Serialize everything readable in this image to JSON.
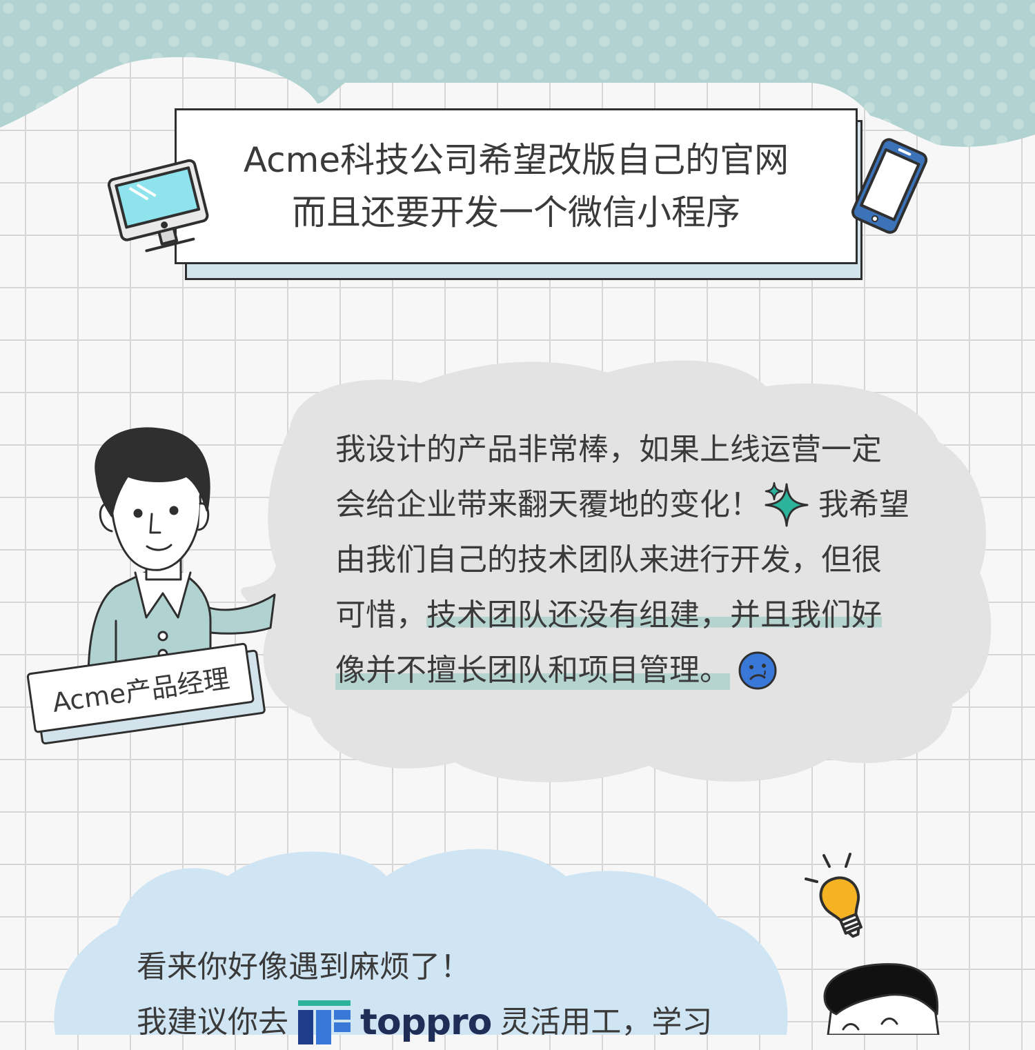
{
  "title": {
    "line1": "Acme科技公司希望改版自己的官网",
    "line2": "而且还要开发一个微信小程序"
  },
  "speech": {
    "row1": "我设计的产品非常棒，如果上线运营一定",
    "row2a": "会给企业带来翻天覆地的变化！",
    "row2b": "我希望",
    "row3": "由我们自己的技术团队来进行开发，但很",
    "row4a": "可惜，",
    "row4b": "技术团队还没有组建，并且我们好",
    "row5": "像并不擅长团队和项目管理。"
  },
  "name_tag": "Acme产品经理",
  "advice": {
    "line1": "看来你好像遇到麻烦了！",
    "line2a": "我建议你去",
    "brand": "toppro",
    "line2b": "灵活用工，学习"
  },
  "icons": [
    "monitor-icon",
    "phone-icon",
    "sparkle-icon",
    "sad-face-icon",
    "lightbulb-icon",
    "toppro-logo-icon"
  ],
  "colors": {
    "sky": "#b0d2d0",
    "speech_bubble": "#e3e3e3",
    "advice_bubble": "#d0e5f3",
    "highlight": "#b5d3cf",
    "accent_teal": "#2bb39c",
    "accent_blue": "#3a78d8",
    "bulb_yellow": "#f5b324",
    "shirt": "#b0d2d0"
  }
}
